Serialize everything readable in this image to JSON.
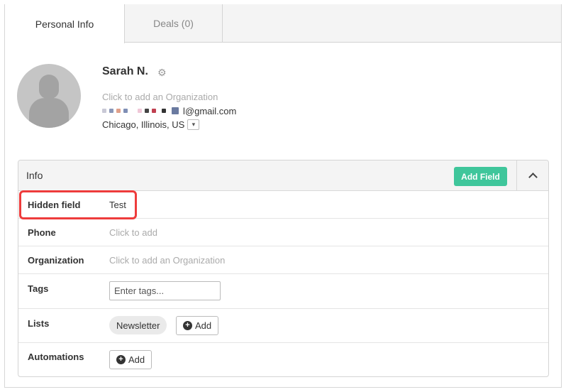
{
  "tabs": [
    {
      "label": "Personal Info",
      "active": true
    },
    {
      "label": "Deals (0)",
      "active": false
    }
  ],
  "contact": {
    "name": "Sarah N.",
    "organization_placeholder": "Click to add an Organization",
    "email_visible": "l@gmail.com",
    "location": "Chicago, Illinois, US"
  },
  "info": {
    "title": "Info",
    "add_field_label": "Add Field",
    "rows": [
      {
        "label": "Hidden field",
        "value": "Test"
      },
      {
        "label": "Phone",
        "value": "Click to add"
      },
      {
        "label": "Organization",
        "value": "Click to add an Organization"
      },
      {
        "label": "Tags",
        "placeholder": "Enter tags..."
      },
      {
        "label": "Lists",
        "pill": "Newsletter",
        "add_label": "Add"
      },
      {
        "label": "Automations",
        "add_label": "Add"
      }
    ]
  },
  "colors": {
    "accent": "#3fc69b",
    "highlight": "#ee3c3c"
  },
  "icons": {
    "settings": "gear-icon",
    "dropdown": "chevron-down-icon",
    "collapse": "chevron-up-icon",
    "add": "plus-circle-icon",
    "avatar": "user-silhouette-icon"
  }
}
